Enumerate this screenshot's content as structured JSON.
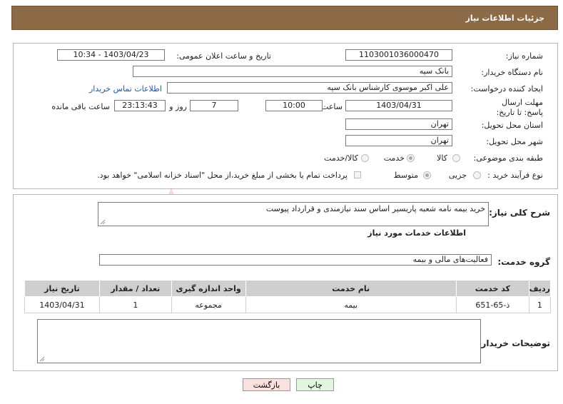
{
  "header": {
    "title": "جزئیات اطلاعات نیاز"
  },
  "form": {
    "need_number_label": "شماره نیاز:",
    "need_number": "1103001036000470",
    "announce_label": "تاریخ و ساعت اعلان عمومی:",
    "announce_value": "1403/04/23 - 10:34",
    "buyer_org_label": "نام دستگاه خریدار:",
    "buyer_org": "بانک سپه",
    "creator_label": "ایجاد کننده درخواست:",
    "creator": "علی اکبر موسوی کارشناس بانک سپه",
    "contact_link": "اطلاعات تماس خریدار",
    "deadline_label": "مهلت ارسال پاسخ: تا تاریخ:",
    "deadline_date": "1403/04/31",
    "time_label": "ساعت",
    "deadline_time": "10:00",
    "days_value": "7",
    "days_label": "روز و",
    "remaining_time": "23:13:43",
    "remaining_label": "ساعت باقی مانده",
    "province_label": "استان محل تحویل:",
    "province": "تهران",
    "city_label": "شهر محل تحویل:",
    "city": "تهران",
    "category_label": "طبقه بندی موضوعی:",
    "category_options": [
      "کالا",
      "خدمت",
      "کالا/خدمت"
    ],
    "category_selected": "خدمت",
    "process_label": "نوع فرآیند خرید :",
    "process_options": [
      "جزیی",
      "متوسط"
    ],
    "process_selected": "متوسط",
    "payment_note": "پرداخت تمام یا بخشی از مبلغ خرید،از محل \"اسناد خزانه اسلامی\" خواهد بود."
  },
  "details": {
    "description_label": "شرح کلی نیاز:",
    "description": "خرید بیمه نامه شعبه پاریسیر اساس سند نیازمندی و قرارداد پیوست",
    "services_title": "اطلاعات خدمات مورد نیاز",
    "service_group_label": "گروه خدمت:",
    "service_group": "فعالیت‌های مالی و بیمه",
    "table": {
      "headers": [
        "ردیف",
        "کد خدمت",
        "نام خدمت",
        "واحد اندازه گیری",
        "تعداد / مقدار",
        "تاریخ نیاز"
      ],
      "rows": [
        [
          "1",
          "ذ-65-651",
          "بیمه",
          "مجموعه",
          "1",
          "1403/04/31"
        ]
      ]
    },
    "buyer_notes_label": "توضیحات خریدار:",
    "buyer_notes": ""
  },
  "buttons": {
    "print": "چاپ",
    "back": "بازگشت"
  },
  "watermark": {
    "text": "AriaTender.neT"
  },
  "colors": {
    "header_bg": "#8b6a45",
    "back_button_bg": "#fbe0e0",
    "print_button_bg": "#e2f6df",
    "link": "#1f55b0"
  }
}
